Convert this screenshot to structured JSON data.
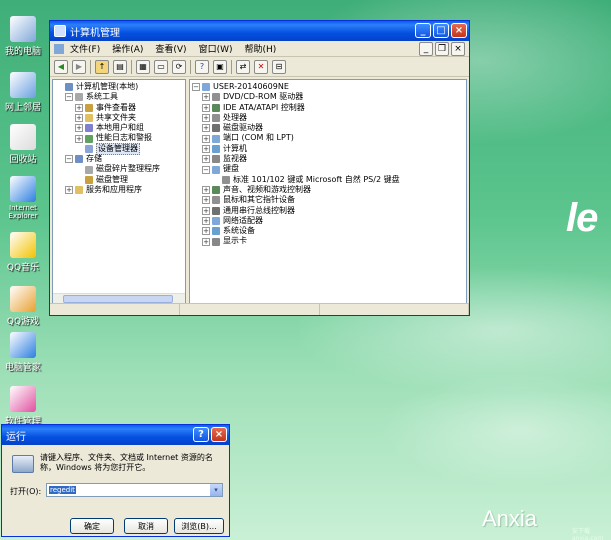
{
  "desktop": {
    "icons": [
      {
        "label": "我的电脑",
        "icon": "my-computer-icon",
        "color": "#7fa8d8"
      },
      {
        "label": "网上邻居",
        "icon": "network-places-icon",
        "color": "#6aa0e0"
      },
      {
        "label": "回收站",
        "icon": "recycle-bin-icon",
        "color": "#dcdcdc"
      },
      {
        "label": "Internet Explorer",
        "icon": "internet-explorer-icon",
        "color": "#2d7fe0"
      },
      {
        "label": "QQ音乐",
        "icon": "qq-music-icon",
        "color": "#f2c200"
      },
      {
        "label": "QQ游戏",
        "icon": "qq-game-icon",
        "color": "#e8a030"
      },
      {
        "label": "电脑管家",
        "icon": "pc-manager-icon",
        "color": "#2b7de0"
      },
      {
        "label": "软件管理",
        "icon": "software-manager-icon",
        "color": "#e050a0"
      }
    ],
    "logo_text": "le",
    "watermark": "Anxia",
    "watermark_sub": "安下载 anxia.com"
  },
  "computer_mgmt": {
    "title": "计算机管理",
    "menu": [
      "文件(F)",
      "操作(A)",
      "查看(V)",
      "窗口(W)",
      "帮助(H)"
    ],
    "left_tree": [
      {
        "label": "计算机管理(本地)",
        "indent": 0,
        "pm": ""
      },
      {
        "label": "系统工具",
        "indent": 1,
        "pm": "−"
      },
      {
        "label": "事件查看器",
        "indent": 2,
        "pm": "+"
      },
      {
        "label": "共享文件夹",
        "indent": 2,
        "pm": "+"
      },
      {
        "label": "本地用户和组",
        "indent": 2,
        "pm": "+"
      },
      {
        "label": "性能日志和警报",
        "indent": 2,
        "pm": "+"
      },
      {
        "label": "设备管理器",
        "indent": 2,
        "pm": ""
      },
      {
        "label": "存储",
        "indent": 1,
        "pm": "−"
      },
      {
        "label": "磁盘碎片整理程序",
        "indent": 2,
        "pm": ""
      },
      {
        "label": "磁盘管理",
        "indent": 2,
        "pm": ""
      },
      {
        "label": "服务和应用程序",
        "indent": 1,
        "pm": "+"
      }
    ],
    "right_tree": [
      {
        "label": "USER-20140609NE",
        "indent": 0,
        "pm": "−"
      },
      {
        "label": "DVD/CD-ROM 驱动器",
        "indent": 1,
        "pm": "+"
      },
      {
        "label": "IDE ATA/ATAPI 控制器",
        "indent": 1,
        "pm": "+"
      },
      {
        "label": "处理器",
        "indent": 1,
        "pm": "+"
      },
      {
        "label": "磁盘驱动器",
        "indent": 1,
        "pm": "+"
      },
      {
        "label": "端口 (COM 和 LPT)",
        "indent": 1,
        "pm": "+"
      },
      {
        "label": "计算机",
        "indent": 1,
        "pm": "+"
      },
      {
        "label": "监视器",
        "indent": 1,
        "pm": "+"
      },
      {
        "label": "键盘",
        "indent": 1,
        "pm": "−"
      },
      {
        "label": "标准 101/102 键或 Microsoft 自然 PS/2 键盘",
        "indent": 2,
        "pm": ""
      },
      {
        "label": "声音、视频和游戏控制器",
        "indent": 1,
        "pm": "+"
      },
      {
        "label": "鼠标和其它指针设备",
        "indent": 1,
        "pm": "+"
      },
      {
        "label": "通用串行总线控制器",
        "indent": 1,
        "pm": "+"
      },
      {
        "label": "网络适配器",
        "indent": 1,
        "pm": "+"
      },
      {
        "label": "系统设备",
        "indent": 1,
        "pm": "+"
      },
      {
        "label": "显示卡",
        "indent": 1,
        "pm": "+"
      }
    ]
  },
  "run_dialog": {
    "title": "运行",
    "prompt": "请键入程序、文件夹、文档或 Internet 资源的名称，Windows 将为您打开它。",
    "open_label": "打开(O):",
    "open_value": "regedit",
    "ok": "确定",
    "cancel": "取消",
    "browse": "浏览(B)..."
  }
}
